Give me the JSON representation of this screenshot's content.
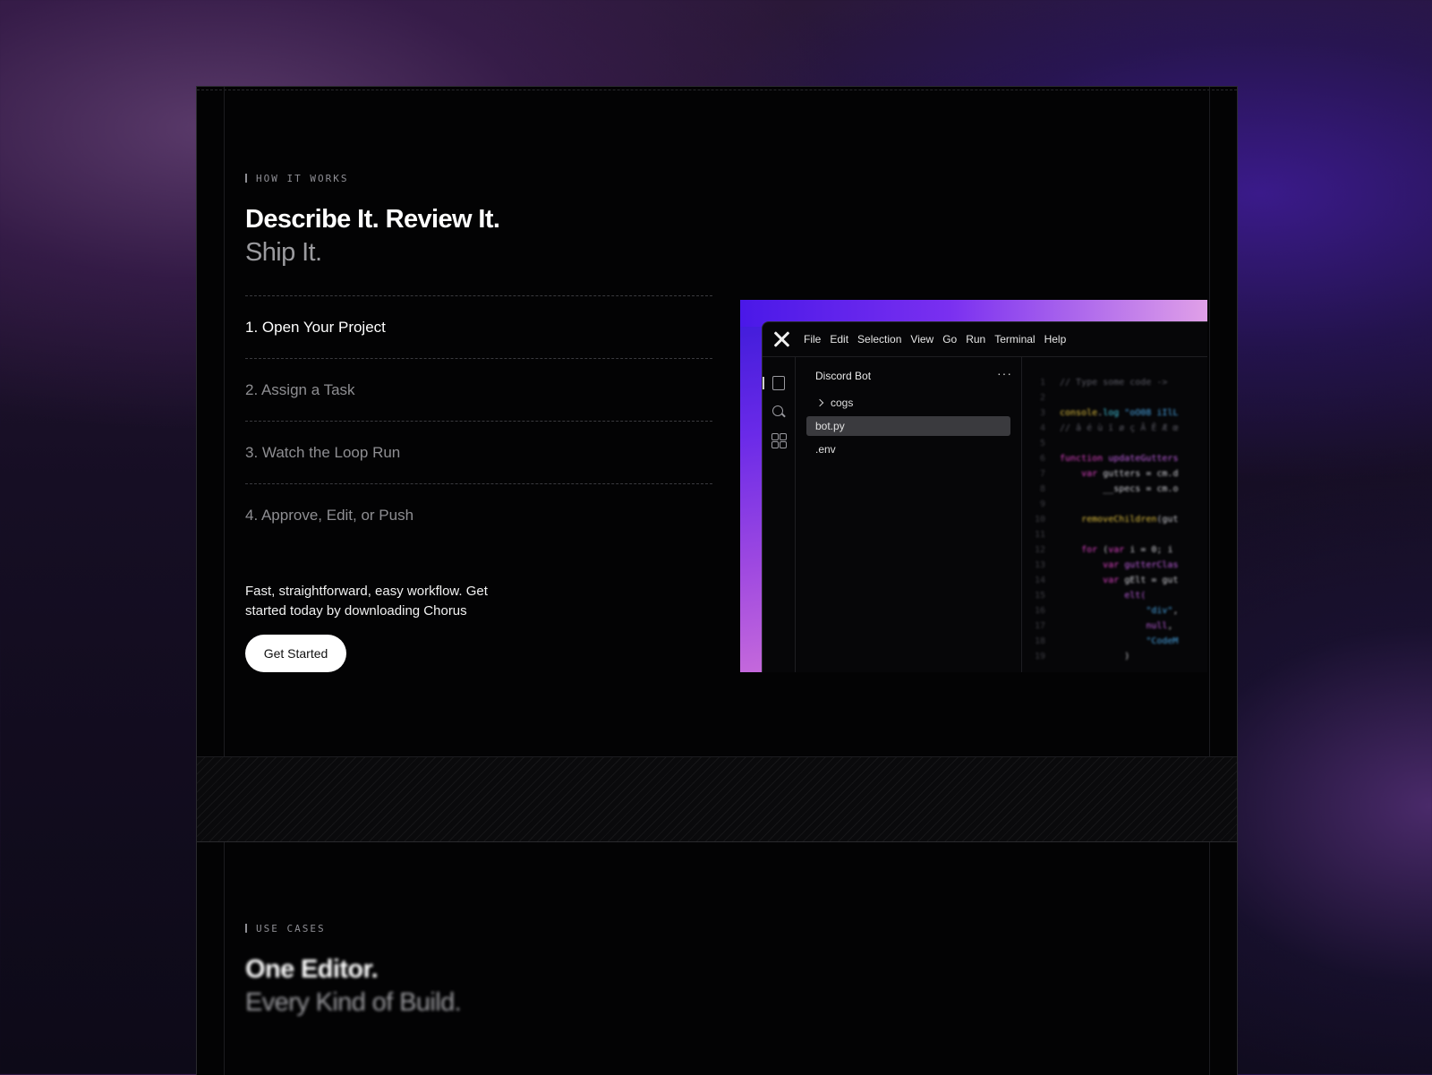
{
  "how_it_works": {
    "label": "HOW IT WORKS",
    "headline_line1": "Describe It. Review It.",
    "headline_line2": "Ship It.",
    "steps": [
      "1. Open Your Project",
      "2. Assign a Task",
      "3. Watch the Loop Run",
      "4. Approve, Edit, or Push"
    ],
    "description": "Fast, straightforward, easy workflow. Get started today by downloading Chorus",
    "cta_label": "Get Started"
  },
  "editor": {
    "menu": [
      "File",
      "Edit",
      "Selection",
      "View",
      "Go",
      "Run",
      "Terminal",
      "Help"
    ],
    "project_name": "Discord Bot",
    "more_label": "···",
    "tree": [
      {
        "name": "cogs",
        "type": "folder"
      },
      {
        "name": "bot.py",
        "type": "file",
        "selected": true
      },
      {
        "name": ".env",
        "type": "file"
      }
    ],
    "line_numbers": [
      "1",
      "2",
      "3",
      "4",
      "5",
      "6",
      "7",
      "8",
      "9",
      "10",
      "11",
      "12",
      "13",
      "14",
      "15",
      "16",
      "17",
      "18",
      "19"
    ]
  },
  "use_cases": {
    "label": "USE CASES",
    "headline_line1": "One Editor.",
    "headline_line2": "Every Kind of Build."
  }
}
